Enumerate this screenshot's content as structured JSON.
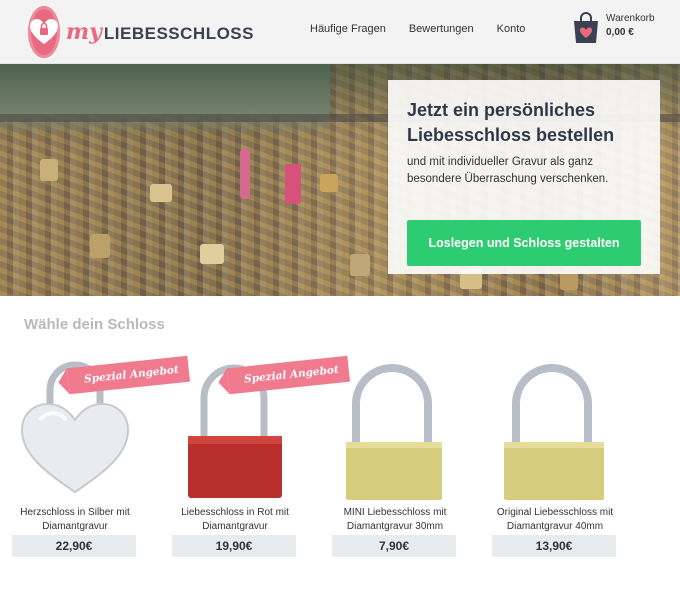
{
  "brand": {
    "prefix": "my",
    "name": "LIEBESSCHLOSS"
  },
  "nav": {
    "faq": "Häufige Fragen",
    "reviews": "Bewertungen",
    "account": "Konto"
  },
  "cart": {
    "label": "Warenkorb",
    "total": "0,00 €"
  },
  "hero": {
    "title": "Jetzt ein persönliches Liebesschloss bestellen",
    "subtitle": "und mit individueller Gravur als ganz besondere Überraschung verschenken.",
    "cta": "Loslegen und Schloss gestalten"
  },
  "section": {
    "title": "Wähle dein Schloss"
  },
  "products": [
    {
      "name": "Herzschloss in Silber mit Diamantgravur",
      "price": "22,90€",
      "badge": "Spezial Angebot"
    },
    {
      "name": "Liebesschloss in Rot mit Diamantgravur",
      "price": "19,90€",
      "badge": "Spezial Angebot"
    },
    {
      "name": "MINI Liebesschloss mit Diamantgravur 30mm",
      "price": "7,90€"
    },
    {
      "name": "Original Liebesschloss mit Diamantgravur 40mm",
      "price": "13,90€"
    }
  ],
  "colors": {
    "accent": "#e86a80",
    "cta": "#2ecc71",
    "dark": "#2f3848",
    "price_bg": "#e9ecef"
  }
}
